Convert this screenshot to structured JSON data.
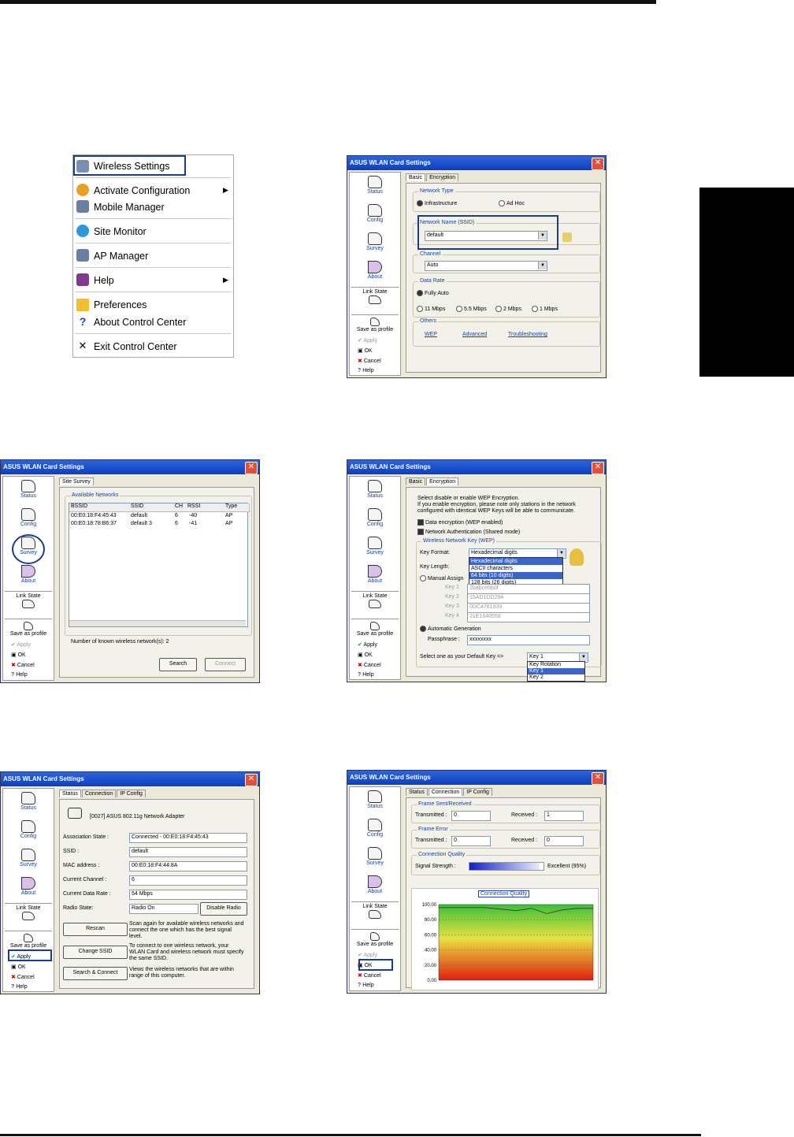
{
  "menu": {
    "items": [
      "Wireless Settings",
      "Activate Configuration",
      "Mobile Manager",
      "Site Monitor",
      "AP Manager",
      "Help",
      "Preferences",
      "About Control Center",
      "Exit Control Center"
    ]
  },
  "common": {
    "title": "ASUS WLAN Card Settings",
    "nav": [
      "Status",
      "Config",
      "Survey",
      "About"
    ],
    "link_state": "Link State",
    "actions": [
      "Save as profile",
      "Apply",
      "OK",
      "Cancel",
      "Help"
    ]
  },
  "w1": {
    "tabs": [
      "Basic",
      "Encryption"
    ],
    "network_type": "Network Type",
    "infra": "Infrastructure",
    "adhoc": "Ad Hoc",
    "ssid_label": "Network Name (SSID)",
    "ssid_value": "default",
    "channel": "Channel",
    "channel_value": "Auto",
    "data_rate": "Data Rate",
    "fully_auto": "Fully Auto",
    "rates": [
      "11 Mbps",
      "5.5 Mbps",
      "2 Mbps",
      "1 Mbps"
    ],
    "others": "Others",
    "links": [
      "WEP",
      "Advanced",
      "Troubleshooting"
    ]
  },
  "w2": {
    "tab": "Site Survey",
    "group": "Available Networks",
    "cols": [
      "BSSID",
      "SSID",
      "CH",
      "RSSI",
      "Type"
    ],
    "rows": [
      [
        "00:E0:18:F4:45:43",
        "default",
        "6",
        "-40",
        "AP"
      ],
      [
        "00:E0:18:78:B6:37",
        "default 3",
        "6",
        "-41",
        "AP"
      ]
    ],
    "count": "Number of known wireless network(s): 2",
    "search": "Search",
    "connect": "Connect"
  },
  "w3": {
    "tabs": [
      "Basic",
      "Encryption"
    ],
    "intro1": "Select disable or enable WEP Encryption.",
    "intro2": "If you enable encryption, please note only stations in the network",
    "intro3": "configured with identical WEP Keys will be able to communicate.",
    "chk1": "Data encryption (WEP enabled)",
    "chk2": "Network Authentication (Shared mode)",
    "group": "Wireless Network Key (WEP)",
    "key_format": "Key Format:",
    "key_format_value": "Hexadecimal digits",
    "format_options": [
      "Hexadecimal digits",
      "ASCII characters",
      "64 bits (10 digits)",
      "128 bits (26 digits)"
    ],
    "key_length": "Key Length:",
    "manual": "Manual Assign",
    "keys": [
      "Key 1",
      "Key 2",
      "Key 3",
      "Key 4"
    ],
    "key_values": [
      "2babcebb0f",
      "15AD1DD294",
      "0DC4761939",
      "21E1640558"
    ],
    "auto": "Automatic Generation",
    "passphrase": "Passphrase :",
    "passphrase_value": "xxxxxxxx",
    "default_key": "Select one as your Default Key =>",
    "default_value": "Key 1",
    "default_options": [
      "Key Rotation",
      "Key 1",
      "Key 2"
    ]
  },
  "w4": {
    "tabs": [
      "Status",
      "Connection",
      "IP Config"
    ],
    "adapter": "[0027] ASUS 802.11g Network Adapter",
    "labels": [
      "Association State :",
      "SSID :",
      "MAC address :",
      "Current Channel :",
      "Current Data Rate :",
      "Radio State:"
    ],
    "values": [
      "Connected - 00:E0:18:F4:45:43",
      "default",
      "00:E0:18:F4:44:8A",
      "6",
      "54 Mbps",
      "Radio On"
    ],
    "disable_radio": "Disable Radio",
    "rescan": "Rescan",
    "rescan_desc": "Scan again for available wireless networks and connect the one which has the best signal level.",
    "change_ssid": "Change SSID",
    "change_desc": "To connect to one wireless network, your WLAN Card and wireless network must specify the same SSID.",
    "search_connect": "Search & Connect",
    "search_desc": "Views the wireless networks that are within range of this computer."
  },
  "w5": {
    "tabs": [
      "Status",
      "Connection",
      "IP Config"
    ],
    "frame_sent": "Frame Sent/Received",
    "frame_error": "Frame Error",
    "transmitted": "Transmitted :",
    "received": "Received :",
    "sent_tx": "0",
    "sent_rx": "1",
    "err_tx": "0",
    "err_rx": "0",
    "quality": "Connection Quality",
    "signal": "Signal Strength :",
    "signal_text": "Excellent (95%)",
    "signal_pct": 95,
    "chart_title": "Connection Quality"
  },
  "chart_data": {
    "type": "line",
    "title": "Connection Quality",
    "yticks": [
      "100.00",
      "80.00",
      "60.00",
      "40.00",
      "20.00",
      "0.00"
    ],
    "ylim": [
      0,
      100
    ],
    "values": [
      96,
      96,
      96,
      96,
      94,
      92,
      95,
      88,
      93,
      95,
      95
    ]
  }
}
